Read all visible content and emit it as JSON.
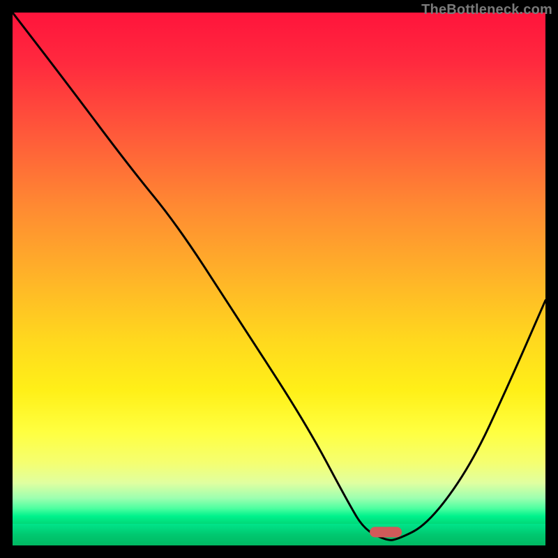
{
  "watermark": "TheBottleneck.com",
  "chart_data": {
    "type": "line",
    "title": "",
    "xlabel": "",
    "ylabel": "",
    "xlim": [
      0,
      100
    ],
    "ylim": [
      0,
      100
    ],
    "x": [
      0,
      10,
      22,
      31,
      42,
      55,
      63,
      66,
      70,
      72,
      78,
      86,
      93,
      100
    ],
    "values": [
      100,
      87,
      71,
      60,
      43,
      23,
      8,
      3,
      1,
      1,
      4,
      15,
      30,
      46
    ],
    "series_name": "bottleneck-curve",
    "optimum_x": 70,
    "optimum_y": 1,
    "marker": {
      "x": 70,
      "color": "#d15a5a",
      "width_pct": 6,
      "height_pct": 2
    }
  },
  "colors": {
    "curve": "#000000",
    "marker": "#d15a5a",
    "background": "#000000"
  }
}
